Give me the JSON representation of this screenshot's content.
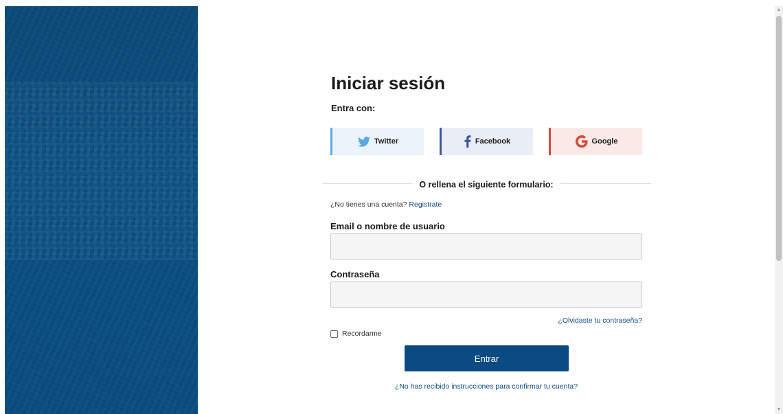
{
  "login": {
    "title": "Iniciar sesión",
    "enter_with": "Entra con:",
    "social": {
      "twitter": "Twitter",
      "facebook": "Facebook",
      "google": "Google"
    },
    "divider_text": "O rellena el siguiente formulario:",
    "register_prompt": "¿No tienes una cuenta?",
    "register_link": "Registrate",
    "email_label": "Email o nombre de usuario",
    "email_value": "",
    "password_label": "Contraseña",
    "password_value": "",
    "forgot_link": "¿Olvidaste tu contraseña?",
    "remember_label": "Recordarme",
    "submit_label": "Entrar",
    "confirm_link": "¿No has recibido instrucciones para confirmar tu cuenta?"
  },
  "colors": {
    "brand_blue": "#0b4a82",
    "twitter": "#59a9e3",
    "facebook": "#3b5998",
    "google": "#d94a38"
  },
  "icons": [
    "twitter-icon",
    "facebook-icon",
    "google-icon",
    "scroll-up-icon",
    "scroll-down-icon"
  ]
}
